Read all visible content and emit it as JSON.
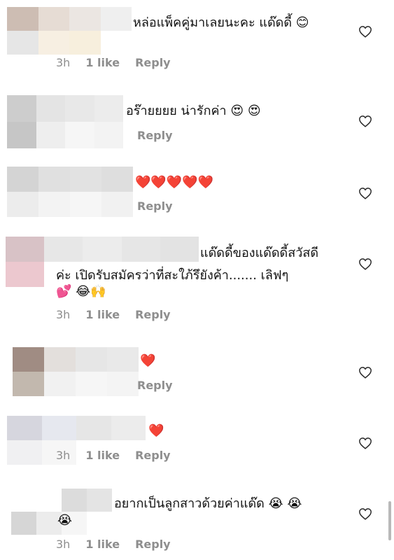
{
  "comments": [
    {
      "text": "หล่อแพ็คคู่มาเลยนะคะ แด๊ดดี้ 😊",
      "time": "3h",
      "likes": "1 like",
      "reply": "Reply"
    },
    {
      "text": "อร๊ายยยย น่ารักค่า 😍 😍",
      "time": "",
      "likes": "",
      "reply": "Reply"
    },
    {
      "text": "❤️❤️❤️❤️❤️",
      "time": "",
      "likes": "",
      "reply": "Reply"
    },
    {
      "text": "แด๊ดดี้ของแด๊ดดี้สวัสดีค่ะ เปิดรับสมัครว่าที่สะใภ้รึยังค้า....... เลิฟๆ 💕 😂🙌",
      "line1": "แด๊ดดี้ของแด๊ดดี้สวัสดี",
      "line2": "ค่ะ เปิดรับสมัครว่าที่สะใภ้รึยังค้า....... เลิฟๆ",
      "line3": "💕 😂🙌",
      "time": "3h",
      "likes": "1 like",
      "reply": "Reply"
    },
    {
      "text": "❤️",
      "time": "",
      "likes": "",
      "reply": "Reply"
    },
    {
      "text": "❤️",
      "time": "3h",
      "likes": "1 like",
      "reply": "Reply"
    },
    {
      "text": "อยากเป็นลูกสาวด้วยค่าแด๊ด 😭 😭",
      "line1": "อยากเป็นลูกสาวด้วยค่าแด๊ด 😭 😭",
      "line2": "😭",
      "time": "3h",
      "likes": "1 like",
      "reply": "Reply"
    }
  ],
  "colors": {
    "meta": "#8e8e8e",
    "heart_outline": "#262626"
  },
  "icons": {
    "like": "heart-outline-icon"
  }
}
